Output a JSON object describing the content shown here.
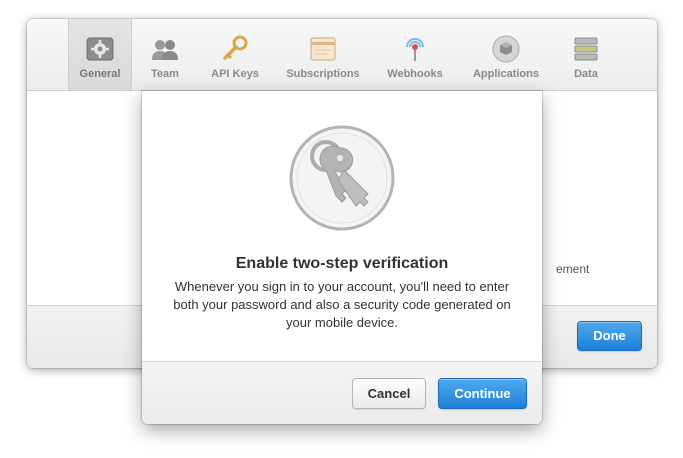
{
  "toolbar": {
    "tabs": [
      {
        "label": "General",
        "icon": "gear-icon",
        "active": true
      },
      {
        "label": "Team",
        "icon": "people-icon",
        "active": false
      },
      {
        "label": "API Keys",
        "icon": "key-icon",
        "active": false
      },
      {
        "label": "Subscriptions",
        "icon": "card-icon",
        "active": false
      },
      {
        "label": "Webhooks",
        "icon": "broadcast-icon",
        "active": false
      },
      {
        "label": "Applications",
        "icon": "cube-icon",
        "active": false
      },
      {
        "label": "Data",
        "icon": "database-icon",
        "active": false
      }
    ]
  },
  "background": {
    "partial_text": "ement",
    "done_label": "Done"
  },
  "dialog": {
    "icon": "keys-icon",
    "title": "Enable two-step verification",
    "body": "Whenever you sign in to your account, you'll need to enter both your password and also a security code generated on your mobile device.",
    "cancel_label": "Cancel",
    "continue_label": "Continue"
  },
  "colors": {
    "primary_button": "#1e80d8",
    "tab_text": "#8a8a8a"
  }
}
